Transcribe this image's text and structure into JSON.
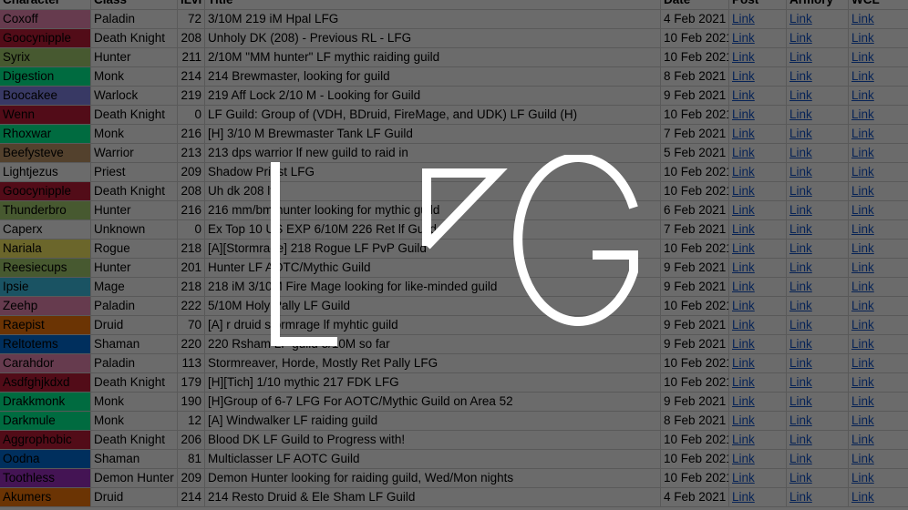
{
  "headers": {
    "character": "Character",
    "class": "Class",
    "ilvl": "iLvl",
    "title": "Title",
    "date": "Date",
    "post": "Post",
    "armory": "Armory",
    "wcl": "WCL"
  },
  "link_label": "Link",
  "logo_text": "LFG",
  "class_colors": {
    "Paladin": "#f48cba",
    "Death Knight": "#c41e3a",
    "Hunter": "#aad372",
    "Monk": "#00ff98",
    "Warlock": "#8788ee",
    "Warrior": "#c69b6d",
    "Priest": "#ffffff",
    "Unknown": "#ffffff",
    "Rogue": "#fff468",
    "Mage": "#3fc7eb",
    "Druid": "#ff7c0a",
    "Shaman": "#0070dd",
    "Demon Hunter": "#a330c9"
  },
  "rows": [
    {
      "character": "Coxoff",
      "class": "Paladin",
      "ilvl": "72",
      "title": "3/10M 219 iM Hpal LFG",
      "date": "4 Feb 2021"
    },
    {
      "character": "Goocynipple",
      "class": "Death Knight",
      "ilvl": "208",
      "title": "Unholy DK (208) - Previous RL - LFG",
      "date": "10 Feb 2021"
    },
    {
      "character": "Syrix",
      "class": "Hunter",
      "ilvl": "211",
      "title": "2/10M \"MM hunter\" LF mythic raiding guild",
      "date": "10 Feb 2021"
    },
    {
      "character": "Digestion",
      "class": "Monk",
      "ilvl": "214",
      "title": "214 Brewmaster, looking for guild",
      "date": "8 Feb 2021"
    },
    {
      "character": "Boocakee",
      "class": "Warlock",
      "ilvl": "219",
      "title": "219 Aff Lock 2/10 M - Looking for Guild",
      "date": "9 Feb 2021"
    },
    {
      "character": "Wenn",
      "class": "Death Knight",
      "ilvl": "0",
      "title": "LF Guild: Group of (VDH, BDruid, FireMage, and UDK) LF Guild (H)",
      "date": "10 Feb 2021"
    },
    {
      "character": "Rhoxwar",
      "class": "Monk",
      "ilvl": "216",
      "title": "[H] 3/10 M Brewmaster Tank LF Guild",
      "date": "7 Feb 2021"
    },
    {
      "character": "Beefysteve",
      "class": "Warrior",
      "ilvl": "213",
      "title": "213 dps warrior lf new guild to raid in",
      "date": "5 Feb 2021"
    },
    {
      "character": "Lightjezus",
      "class": "Priest",
      "ilvl": "209",
      "title": "Shadow Priest LFG",
      "date": "10 Feb 2021"
    },
    {
      "character": "Goocynipple",
      "class": "Death Knight",
      "ilvl": "208",
      "title": "Uh dk 208 lf",
      "date": "10 Feb 2021"
    },
    {
      "character": "Thunderbro",
      "class": "Hunter",
      "ilvl": "216",
      "title": "216 mm/bm hunter looking for mythic guild",
      "date": "6 Feb 2021"
    },
    {
      "character": "Caperx",
      "class": "Unknown",
      "ilvl": "0",
      "title": "Ex Top 10 US EXP 6/10M 226 Ret lf Guild",
      "date": "7 Feb 2021"
    },
    {
      "character": "Nariala",
      "class": "Rogue",
      "ilvl": "218",
      "title": "[A][Stormrage] 218 Rogue LF PvP Guild",
      "date": "10 Feb 2021"
    },
    {
      "character": "Reesiecups",
      "class": "Hunter",
      "ilvl": "201",
      "title": "Hunter LF AOTC/Mythic Guild",
      "date": "9 Feb 2021"
    },
    {
      "character": "Ipsie",
      "class": "Mage",
      "ilvl": "218",
      "title": "218 iM 3/10M Fire Mage looking for like-minded guild",
      "date": "9 Feb 2021"
    },
    {
      "character": "Zeehp",
      "class": "Paladin",
      "ilvl": "222",
      "title": "5/10M Holy Pally LF Guild",
      "date": "10 Feb 2021"
    },
    {
      "character": "Raepist",
      "class": "Druid",
      "ilvl": "70",
      "title": "[A] r druid stormrage lf myhtic guild",
      "date": "9 Feb 2021"
    },
    {
      "character": "Reltotems",
      "class": "Shaman",
      "ilvl": "220",
      "title": "220 Rsham LF guild 3/10M so far",
      "date": "9 Feb 2021"
    },
    {
      "character": "Carahdor",
      "class": "Paladin",
      "ilvl": "113",
      "title": "Stormreaver, Horde, Mostly Ret Pally LFG",
      "date": "10 Feb 2021"
    },
    {
      "character": "Asdfghjkdxd",
      "class": "Death Knight",
      "ilvl": "179",
      "title": "[H][Tich] 1/10 mythic 217 FDK LFG",
      "date": "10 Feb 2021"
    },
    {
      "character": "Drakkmonk",
      "class": "Monk",
      "ilvl": "190",
      "title": "[H]Group of 6-7 LFG For AOTC/Mythic Guild on Area 52",
      "date": "9 Feb 2021"
    },
    {
      "character": "Darkmule",
      "class": "Monk",
      "ilvl": "12",
      "title": "[A] Windwalker LF raiding guild",
      "date": "8 Feb 2021"
    },
    {
      "character": "Aggrophobic",
      "class": "Death Knight",
      "ilvl": "206",
      "title": "Blood DK LF Guild to Progress with!",
      "date": "10 Feb 2021"
    },
    {
      "character": "Oodna",
      "class": "Shaman",
      "ilvl": "81",
      "title": "Multiclasser LF AOTC Guild",
      "date": "10 Feb 2021"
    },
    {
      "character": "Toothless",
      "class": "Demon Hunter",
      "ilvl": "209",
      "title": "Demon Hunter looking for raiding guild, Wed/Mon nights",
      "date": "10 Feb 2021"
    },
    {
      "character": "Akumers",
      "class": "Druid",
      "ilvl": "214",
      "title": "214 Resto Druid & Ele Sham LF Guild",
      "date": "4 Feb 2021"
    }
  ]
}
